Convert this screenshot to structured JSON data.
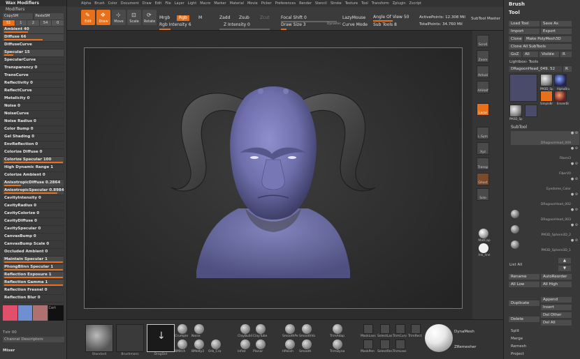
{
  "left_panel": {
    "title": "Wax Modifiers",
    "subtitle": "Modifiers",
    "copy_row": [
      "CopySM",
      "PasteSM"
    ],
    "number_row": [
      "S1",
      "1",
      "2",
      "54",
      "0"
    ],
    "sliders": [
      {
        "label": "Ambient 40",
        "fill": 0.4
      },
      {
        "label": "Diffuse 66",
        "fill": 0.66
      },
      {
        "label": "DiffuseCurve",
        "fill": 0
      },
      {
        "label": "Specular 15",
        "fill": 0.15
      },
      {
        "label": "SpecularCurve",
        "fill": 0
      },
      {
        "label": "Transparency 0",
        "fill": 0
      },
      {
        "label": "TransCurve",
        "fill": 0
      },
      {
        "label": "Reflectivity 0",
        "fill": 0
      },
      {
        "label": "ReflectCurve",
        "fill": 0
      },
      {
        "label": "Metalicity 0",
        "fill": 0
      },
      {
        "label": "Noise 0",
        "fill": 0
      },
      {
        "label": "NoiseCurve",
        "fill": 0
      },
      {
        "label": "Noise Radius 0",
        "fill": 0
      },
      {
        "label": "Color Bump 0",
        "fill": 0
      },
      {
        "label": "Gel Shading 0",
        "fill": 0
      },
      {
        "label": "EnvReflection 0",
        "fill": 0
      },
      {
        "label": "Colorize Diffuse 0",
        "fill": 0
      },
      {
        "label": "Colorize Specular 100",
        "fill": 1.0
      },
      {
        "label": "High Dynamic Range 1",
        "fill": 0
      },
      {
        "label": "Colorize Ambient 0",
        "fill": 0
      },
      {
        "label": "AnisotropicDiffuse 0.2864",
        "fill": 0.29
      },
      {
        "label": "AnisotropicSpecular 0.8984",
        "fill": 0.9
      },
      {
        "label": "CavityIntensity 0",
        "fill": 0
      },
      {
        "label": "CavityRadius 0",
        "fill": 0
      },
      {
        "label": "CavityColorize 0",
        "fill": 0
      },
      {
        "label": "CavityDiffuse 0",
        "fill": 0
      },
      {
        "label": "CavitySpecular 0",
        "fill": 0
      },
      {
        "label": "CanvasBump 0",
        "fill": 0
      },
      {
        "label": "CanvasBump Scale 0",
        "fill": 0
      },
      {
        "label": "Occluded   Ambient 0",
        "fill": 0
      },
      {
        "label": "Maintain Specular 1",
        "fill": 1.0
      },
      {
        "label": "PhongBlinn Specular 1",
        "fill": 1.0
      },
      {
        "label": "Reflection Exposure 1",
        "fill": 1.0
      },
      {
        "label": "Reflection Gamma 1",
        "fill": 1.0
      },
      {
        "label": "Reflection Fresnel 0",
        "fill": 0
      },
      {
        "label": "Reflection Blur 0",
        "fill": 0
      }
    ],
    "swatches": [
      "#e0506a",
      "#6f8fd0",
      "#b07070"
    ],
    "swatch_dark_label": "Cert",
    "bottom_label_1": "Txtr 00",
    "bottom_label_2": "Channel Descriptors",
    "bottom_label_3": "Mixer"
  },
  "menu": [
    "Alpha",
    "Brush",
    "Color",
    "Document",
    "Draw",
    "Edit",
    "File",
    "Layer",
    "Light",
    "Macro",
    "Marker",
    "Material",
    "Movie",
    "Picker",
    "Preferences",
    "Render",
    "Stencil",
    "Stroke",
    "Texture",
    "Tool",
    "Transform",
    "Zplugin",
    "Zscript"
  ],
  "toolbar": {
    "edit": "Edit",
    "draw": "Draw",
    "move": "Move",
    "scale": "Scale",
    "rotate": "Rotate",
    "mrgb": "Mrgb",
    "rgb": "Rgb",
    "m": "M",
    "rgb_intensity": "Rgb Intensity 6",
    "zadd": "Zadd",
    "zsub": "Zsub",
    "zcut": "Zcut",
    "z_intensity": "Z Intensity 0",
    "focal_shift": "Focal Shift 0",
    "draw_size": "Draw Size 3",
    "dynamic": "Dynamic",
    "lazymouse": "LazyMouse",
    "curve_mode": "Curve Mode",
    "angle_of_view": "Angle Of View 50",
    "sub_tools": "Sub Tools 8",
    "active_points": "ActivePoints: 12.308 Mil",
    "total_points": "TotalPoints: 34.760 Mil",
    "subtool_master": "SubTool Master"
  },
  "right_strip": {
    "scroll": "Scroll",
    "zoom": "Zoom",
    "actual": "Actual",
    "aahalf": "AAHalf",
    "local": "Local",
    "lsym": "L.Sym",
    "xyz": "Xyz",
    "transp": "Transp",
    "ghost": "Ghost",
    "solo": "Solo",
    "mat_cap": "MatCap",
    "ink_line": "Ink_line"
  },
  "right_panel": {
    "brush_title": "Brush",
    "tool_title": "Tool",
    "load_tool": "Load Tool",
    "save_as": "Save As",
    "import": "Import",
    "export": "Export",
    "clone": "Clone",
    "make_polymesh": "Make PolyMesh3D",
    "clone_all_subtools": "Clone All SubTools",
    "goz": "GoZ",
    "all": "All",
    "visible": "Visible",
    "r": "R",
    "lightbox_tools": "Lightbox› Tools",
    "current_tool": "DRagoonHead_049. 52",
    "r2": "R",
    "thumb_labels": [
      "PM3D_Sp",
      "AlphaBru",
      "SimpleBr",
      "EraserBr",
      "PM3D_Sp"
    ],
    "subtool_title": "SubTool",
    "subtools": [
      "DRagoonHead_009",
      "Fiberz3",
      "FiberV0",
      "Eyedome_Color",
      "DRagoonHead_002",
      "DRagoonHead_003",
      "PM3D_Sphere3D_2",
      "PM3D_Sphere3D_1"
    ],
    "list_all": "List All",
    "rename": "Rename",
    "auto_reorder": "AutoReorder",
    "all_low": "All Low",
    "all_high": "All High",
    "append": "Append",
    "duplicate": "Duplicate",
    "insert": "Insert",
    "delete": "Delete",
    "del_other": "Del Other",
    "del_all": "Del All",
    "split": "Split",
    "merge": "Merge",
    "remesh": "Remesh",
    "project": "Project"
  },
  "bottom_shelf": {
    "big_thumbs": [
      "Standard",
      "Brushmans",
      "DragDot"
    ],
    "brushes": [
      {
        "name": "Crumple"
      },
      {
        "name": "Noise"
      },
      {
        "name": "BMitch"
      },
      {
        "name": "BMelty2"
      },
      {
        "name": "Orb_Cra"
      },
      {
        "name": "ClayBuild"
      },
      {
        "name": "ClayTube"
      },
      {
        "name": "Inflat"
      },
      {
        "name": "Planar"
      },
      {
        "name": "SmoothPe"
      },
      {
        "name": "SmoothVa"
      },
      {
        "name": "hPolish"
      },
      {
        "name": "Smooth"
      },
      {
        "name": "TrimAdap"
      },
      {
        "name": "TrimDyna"
      },
      {
        "name": "MaskLass"
      },
      {
        "name": "SelectLas"
      },
      {
        "name": "TrimCurv"
      },
      {
        "name": "TrimRect"
      },
      {
        "name": "MaskPen"
      },
      {
        "name": "SelectRec"
      },
      {
        "name": "TrimLass"
      }
    ],
    "dynamesh": "DynaMesh",
    "zremesher": "ZRemesher"
  }
}
